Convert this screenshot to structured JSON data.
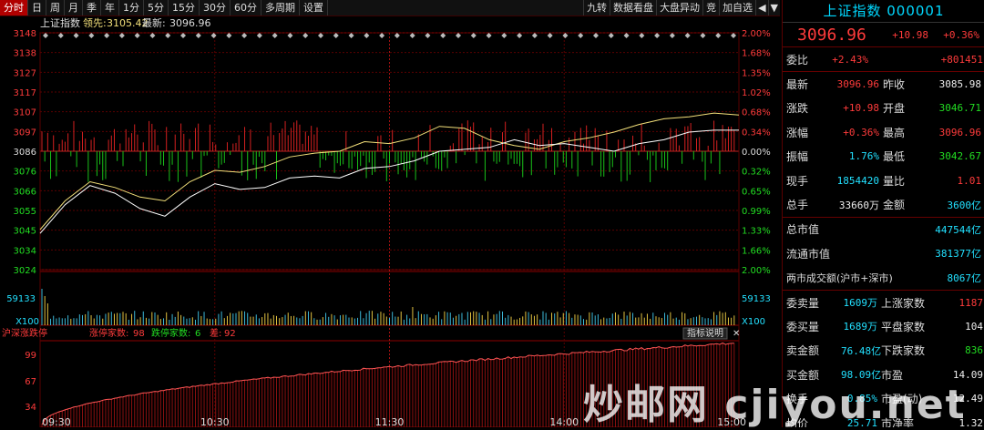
{
  "tabs": [
    "分时",
    "日",
    "周",
    "月",
    "季",
    "年",
    "1分",
    "5分",
    "15分",
    "30分",
    "60分",
    "多周期",
    "设置"
  ],
  "active_tab": 0,
  "toolbar_right": [
    "九转",
    "数据看盘",
    "大盘异动",
    "竞",
    "加自选",
    "◀",
    "▼"
  ],
  "chart": {
    "legend_name": "上证指数",
    "legend_lead_label": "领先:",
    "legend_lead_value": "3105.42",
    "legend_latest_label": "最新:",
    "legend_latest_value": "3096.96",
    "price_ticks": [
      "3148",
      "3138",
      "3127",
      "3117",
      "3107",
      "3097",
      "3086",
      "3076",
      "3066",
      "3055",
      "3045",
      "3034",
      "3024"
    ],
    "pct_ticks": [
      "2.00%",
      "1.68%",
      "1.35%",
      "1.02%",
      "0.68%",
      "0.34%",
      "0.00%",
      "0.32%",
      "0.65%",
      "0.99%",
      "1.33%",
      "1.66%",
      "2.00%"
    ],
    "volume_max_label": "59133",
    "volume_unit_label": "X100",
    "breadth_title": "沪深涨跌停",
    "breadth_up_label": "涨停家数:",
    "breadth_up_value": "98",
    "breadth_down_label": "跌停家数:",
    "breadth_down_value": "6",
    "breadth_diff_label": "差:",
    "breadth_diff_value": "92",
    "indicator_help": "指标说明",
    "breadth_ticks": [
      "99",
      "67",
      "34"
    ],
    "time_ticks": [
      "09:30",
      "10:30",
      "11:30",
      "14:00",
      "15:00"
    ]
  },
  "chart_data": {
    "type": "line",
    "title": "上证指数",
    "x_ticks": [
      "09:30",
      "10:30",
      "11:30",
      "14:00",
      "15:00"
    ],
    "ylim": [
      3024,
      3148
    ],
    "prev_close": 3085.98,
    "series": [
      {
        "name": "最新",
        "values": [
          3043,
          3058,
          3068,
          3064,
          3056,
          3052,
          3062,
          3069,
          3066,
          3067,
          3072,
          3073,
          3072,
          3077,
          3078,
          3081,
          3086,
          3087,
          3088,
          3092,
          3089,
          3090,
          3088,
          3086,
          3090,
          3092,
          3096,
          3097,
          3097
        ]
      },
      {
        "name": "领先",
        "values": [
          3045,
          3060,
          3070,
          3067,
          3062,
          3060,
          3070,
          3076,
          3075,
          3078,
          3083,
          3085,
          3086,
          3091,
          3090,
          3093,
          3099,
          3098,
          3092,
          3089,
          3087,
          3091,
          3093,
          3096,
          3100,
          3103,
          3104,
          3106,
          3105
        ]
      }
    ],
    "breadth": {
      "name": "涨停家数",
      "start": 3,
      "end": 98,
      "max": 99
    }
  },
  "panel": {
    "title": "上证指数 000001",
    "price": "3096.96",
    "change": "+10.98",
    "change_pct": "+0.36%",
    "weibi_label": "委比",
    "weibi_pct": "+2.43%",
    "weibi_diff": "+801451",
    "rows": [
      {
        "l1": "最新",
        "v1": "3096.96",
        "c1": "red",
        "l2": "昨收",
        "v2": "3085.98",
        "c2": "white"
      },
      {
        "l1": "涨跌",
        "v1": "+10.98",
        "c1": "red",
        "l2": "开盘",
        "v2": "3046.71",
        "c2": "green"
      },
      {
        "l1": "涨幅",
        "v1": "+0.36%",
        "c1": "red",
        "l2": "最高",
        "v2": "3096.96",
        "c2": "red"
      },
      {
        "l1": "振幅",
        "v1": "1.76%",
        "c1": "cyan",
        "l2": "最低",
        "v2": "3042.67",
        "c2": "green"
      },
      {
        "l1": "现手",
        "v1": "1854420",
        "c1": "cyan",
        "l2": "量比",
        "v2": "1.01",
        "c2": "red"
      },
      {
        "l1": "总手",
        "v1": "33660万",
        "c1": "white",
        "l2": "金额",
        "v2": "3600亿",
        "c2": "cyan"
      }
    ],
    "market_cap_label": "总市值",
    "market_cap_value": "447544亿",
    "float_cap_label": "流通市值",
    "float_cap_value": "381377亿",
    "turnover_label": "两市成交额(沪市+深市)",
    "turnover_value": "8067亿",
    "rows2": [
      {
        "l1": "委卖量",
        "v1": "1609万",
        "l2": "上涨家数",
        "v2": "1187",
        "c2": "red"
      },
      {
        "l1": "委买量",
        "v1": "1689万",
        "l2": "平盘家数",
        "v2": "104",
        "c2": "white"
      },
      {
        "l1": "卖金额",
        "v1": "76.48亿",
        "l2": "下跌家数",
        "v2": "836",
        "c2": "green"
      },
      {
        "l1": "买金额",
        "v1": "98.09亿",
        "l2": "市盈",
        "v2": "14.09",
        "c2": "white"
      },
      {
        "l1": "换手",
        "v1": "0.85%",
        "l2": "市盈(动)",
        "v2": "12.49",
        "c2": "white"
      },
      {
        "l1": "均价",
        "v1": "25.71",
        "l2": "市净率",
        "v2": "1.32",
        "c2": "white"
      }
    ]
  },
  "watermark": "炒邮网 cjiyou.net"
}
